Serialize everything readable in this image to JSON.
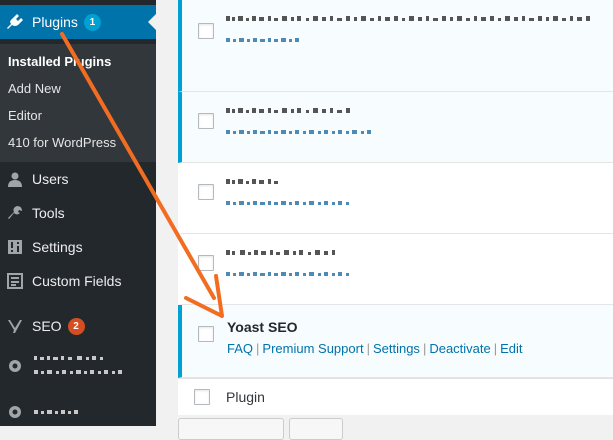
{
  "sidebar": {
    "plugins": {
      "label": "Plugins",
      "count": "1"
    },
    "submenu": [
      {
        "label": "Installed Plugins",
        "current": true
      },
      {
        "label": "Add New",
        "current": false
      },
      {
        "label": "Editor",
        "current": false
      },
      {
        "label": "410 for WordPress",
        "current": false
      }
    ],
    "items": [
      {
        "label": "Users",
        "icon": "users-icon"
      },
      {
        "label": "Tools",
        "icon": "wrench-icon"
      },
      {
        "label": "Settings",
        "icon": "settings-icon"
      },
      {
        "label": "Custom Fields",
        "icon": "fields-icon"
      }
    ],
    "seo": {
      "label": "SEO",
      "count": "2"
    }
  },
  "plugins_table": {
    "highlighted": {
      "title": "Yoast SEO",
      "actions": [
        "FAQ",
        "Premium Support",
        "Settings",
        "Deactivate",
        "Edit"
      ]
    },
    "footer_column": "Plugin"
  },
  "colors": {
    "sidebar_bg": "#23282d",
    "active_blue": "#0073aa",
    "badge_blue": "#00a0d2",
    "badge_red": "#d54e21",
    "annotation_arrow": "#f26d21"
  }
}
